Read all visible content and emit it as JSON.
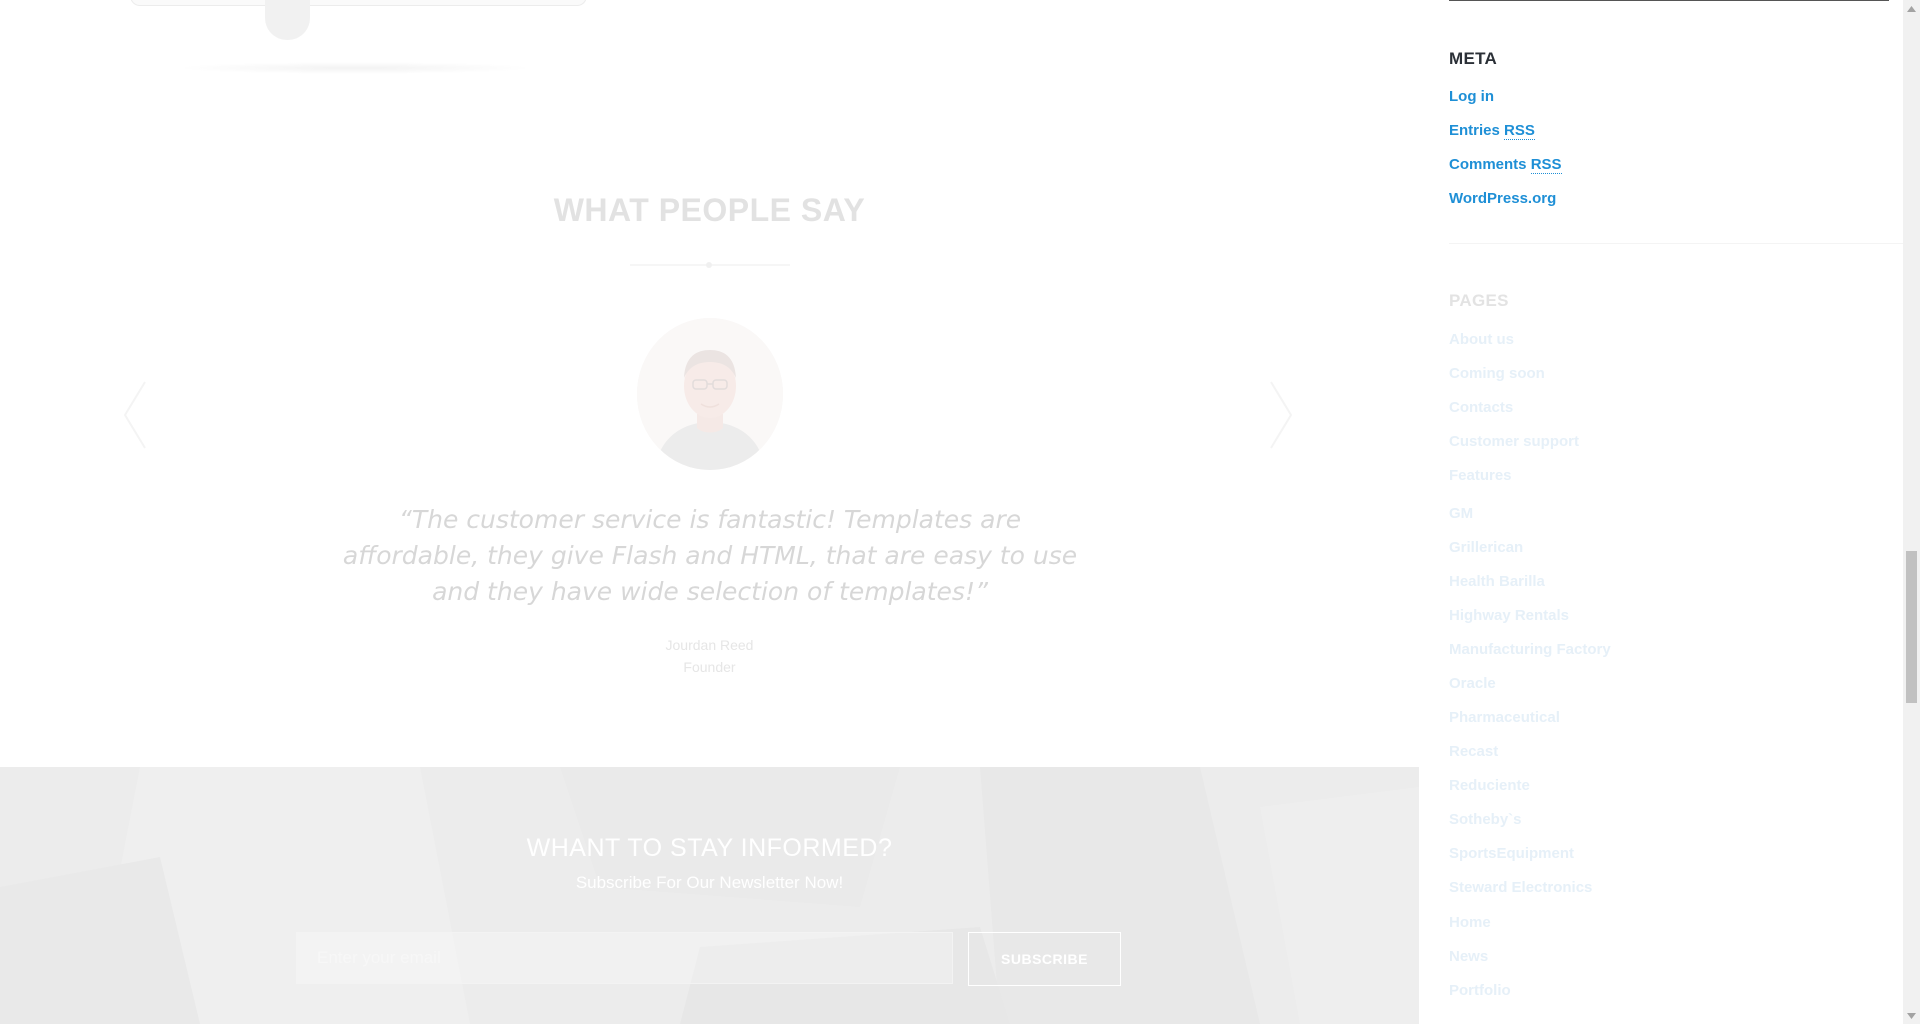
{
  "testimonials": {
    "title": "WHAT PEOPLE SAY",
    "quote": "“The customer service is fantastic! Templates are affordable, they give Flash and HTML, that are easy to use and they have wide selection of templates!”",
    "author_name": "Jourdan Reed",
    "author_role": "Founder"
  },
  "newsletter": {
    "title": "WHANT TO STAY INFORMED?",
    "subtitle": "Subscribe For Our Newsletter Now!",
    "email_placeholder": "Enter your email",
    "subscribe_label": "SUBSCRIBE"
  },
  "sidebar": {
    "meta": {
      "title": "META",
      "links": [
        {
          "text": "Log in"
        },
        {
          "text": "Entries",
          "abbr": "RSS"
        },
        {
          "text": "Comments",
          "abbr": "RSS"
        },
        {
          "text": "WordPress.org"
        }
      ]
    },
    "pages": {
      "title": "PAGES",
      "links": [
        "About us",
        "Coming soon",
        "Contacts",
        "Customer support",
        "Features",
        "GM",
        "Grillerican",
        "Health Barilla",
        "Highway Rentals",
        "Manufacturing Factory",
        "Oracle",
        "Pharmaceutical",
        "Recast",
        "Reduciente",
        "Sotheby`s",
        "SportsEquipment",
        "Steward Electronics",
        "Home",
        "News",
        "Portfolio"
      ]
    }
  },
  "colors": {
    "link": "#1e8fd6",
    "heading": "#2b3037",
    "faded_text": "#e3e3e3",
    "newsletter_bg": "#ececec"
  },
  "icons": {
    "prev": "chevron-left-icon",
    "next": "chevron-right-icon"
  }
}
